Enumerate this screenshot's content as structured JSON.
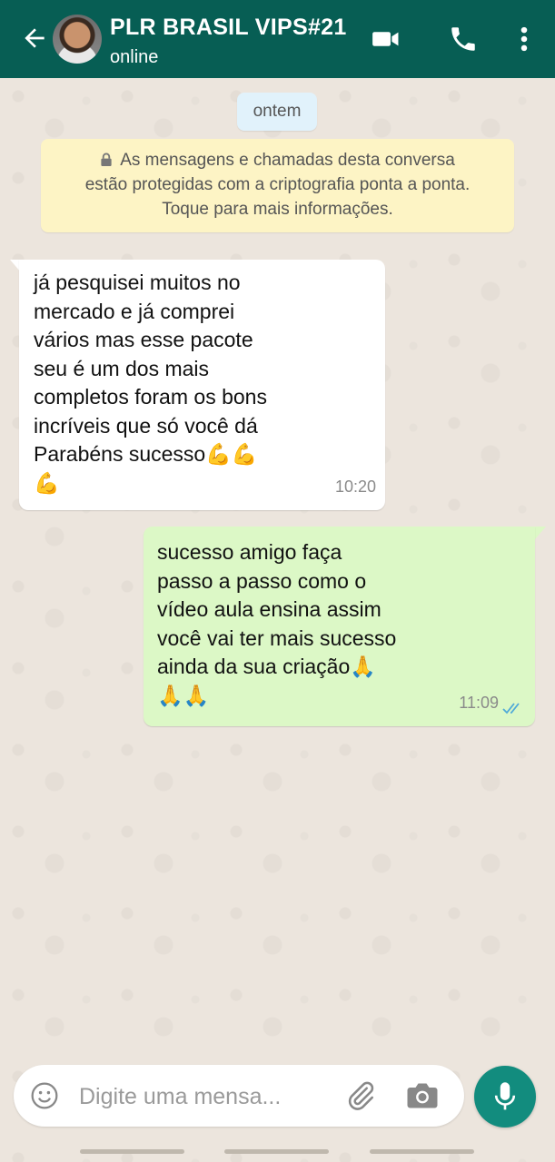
{
  "header": {
    "back_icon": "arrow-left-icon",
    "title": "PLR BRASIL VIPS#21",
    "status": "online",
    "actions": [
      "video-call-icon",
      "phone-icon",
      "more-vertical-icon"
    ],
    "background_color": "#075e54"
  },
  "conversation": {
    "date_chip": "ontem",
    "encryption_notice": {
      "icon": "lock-icon",
      "line1": "As mensagens e chamadas desta conversa",
      "line2": "estão protegidas com a criptografia ponta a ponta.",
      "line3": "Toque para mais informações."
    },
    "messages": [
      {
        "direction": "incoming",
        "text": "já pesquisei muitos no\nmercado e já comprei\nvários mas esse pacote\nseu é um dos mais\ncompletos foram os bons\nincríveis que só você dá\nParabéns sucesso💪💪\n💪",
        "emoji_icon": "flexed-biceps-emoji",
        "time": "10:20",
        "bubble_color": "#ffffff"
      },
      {
        "direction": "outgoing",
        "text": "sucesso amigo faça\npasso a passo como o\nvídeo aula ensina assim\nvocê vai ter mais sucesso\nainda da sua criação🙏\n🙏🙏",
        "emoji_icon": "folded-hands-emoji",
        "time": "11:09",
        "status_icon": "double-check-icon",
        "bubble_color": "#dcf8c6"
      }
    ]
  },
  "composer": {
    "emoji_icon": "smiley-icon",
    "placeholder": "Digite uma mensa...",
    "attach_icon": "paperclip-icon",
    "camera_icon": "camera-icon",
    "mic_icon": "microphone-icon",
    "accent_color": "#128c7e"
  }
}
